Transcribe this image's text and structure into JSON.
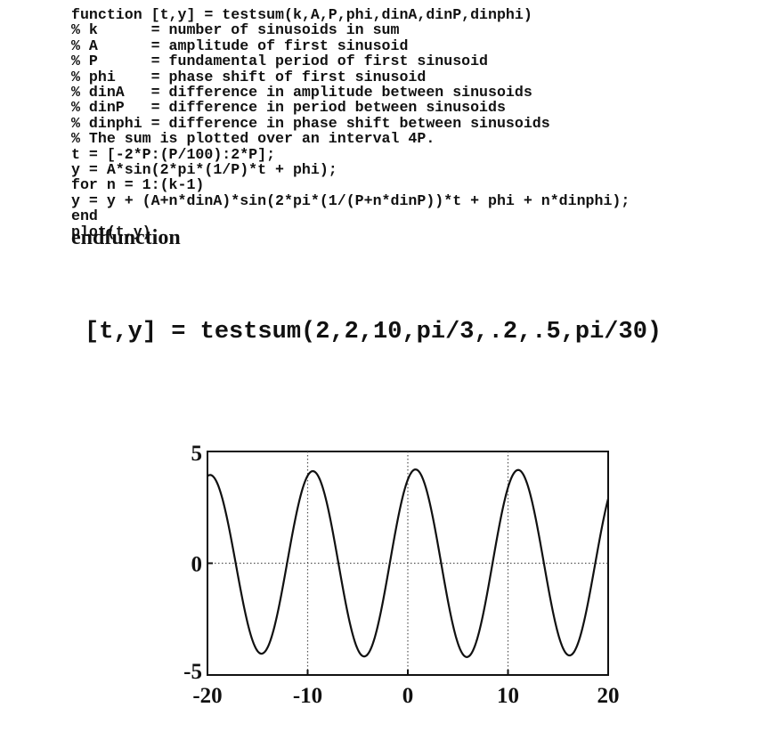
{
  "code_lines": [
    "function [t,y] = testsum(k,A,P,phi,dinA,dinP,dinphi)",
    "% k      = number of sinusoids in sum",
    "% A      = amplitude of first sinusoid",
    "% P      = fundamental period of first sinusoid",
    "% phi    = phase shift of first sinusoid",
    "% dinA   = difference in amplitude between sinusoids",
    "% dinP   = difference in period between sinusoids",
    "% dinphi = difference in phase shift between sinusoids",
    "% The sum is plotted over an interval 4P.",
    "t = [-2*P:(P/100):2*P];",
    "y = A*sin(2*pi*(1/P)*t + phi);",
    "for n = 1:(k-1)",
    "y = y + (A+n*dinA)*sin(2*pi*(1/(P+n*dinP))*t + phi + n*dinphi);",
    "end",
    "plot(t,y)"
  ],
  "endfunction": "endfunction",
  "call": "[t,y] = testsum(2,2,10,pi/3,.2,.5,pi/30)",
  "chart_data": {
    "type": "line",
    "function": "sum of sinusoids from testsum",
    "params": {
      "k": 2,
      "A": 2,
      "P": 10,
      "phi": 1.0472,
      "dinA": 0.2,
      "dinP": 0.5,
      "dinphi": 0.10472
    },
    "xlim": [
      -20,
      20
    ],
    "ylim": [
      -5,
      5
    ],
    "x_ticks": [
      "-20",
      "-10",
      "0",
      "10",
      "20"
    ],
    "y_ticks": [
      "5",
      "0",
      "-5"
    ],
    "grid": "dotted at x=-10,0,10 and y=0",
    "line_color": "#111111"
  }
}
